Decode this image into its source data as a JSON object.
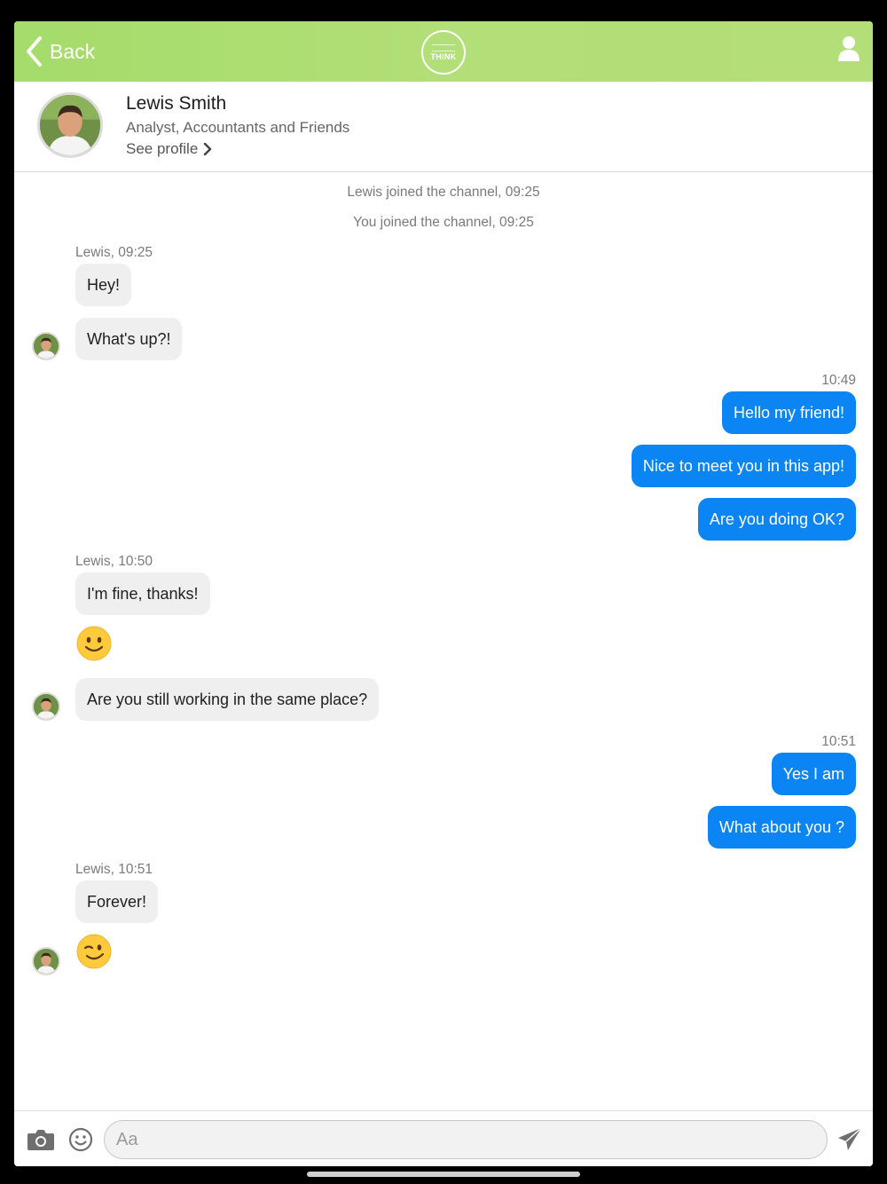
{
  "header": {
    "back_label": "Back",
    "logo_text": "THINK"
  },
  "contact": {
    "name": "Lewis Smith",
    "subtitle": "Analyst, Accountants and Friends",
    "see_profile": "See profile"
  },
  "chat": {
    "system": [
      "Lewis joined the channel, 09:25",
      "You joined the channel, 09:25"
    ],
    "meta": {
      "m1": "Lewis, 09:25",
      "m2": "10:49",
      "m3": "Lewis, 10:50",
      "m4": "10:51",
      "m5": "Lewis, 10:51"
    },
    "messages": {
      "in1": "Hey!",
      "in2": "What's up?!",
      "out1": "Hello my friend!",
      "out2": "Nice to meet you in this app!",
      "out3": "Are you doing OK?",
      "in3": "I'm fine, thanks!",
      "in4": "Are you still working in the same place?",
      "out4": "Yes I am",
      "out5": "What about you ?",
      "in5": "Forever!"
    },
    "emojis": [
      "slightly-smiling-face-icon",
      "winking-face-icon"
    ]
  },
  "composer": {
    "placeholder": "Aa"
  },
  "colors": {
    "header_green": "#a5dc6b",
    "outgoing_bubble": "#0b84f4",
    "incoming_bubble": "#efefef"
  }
}
